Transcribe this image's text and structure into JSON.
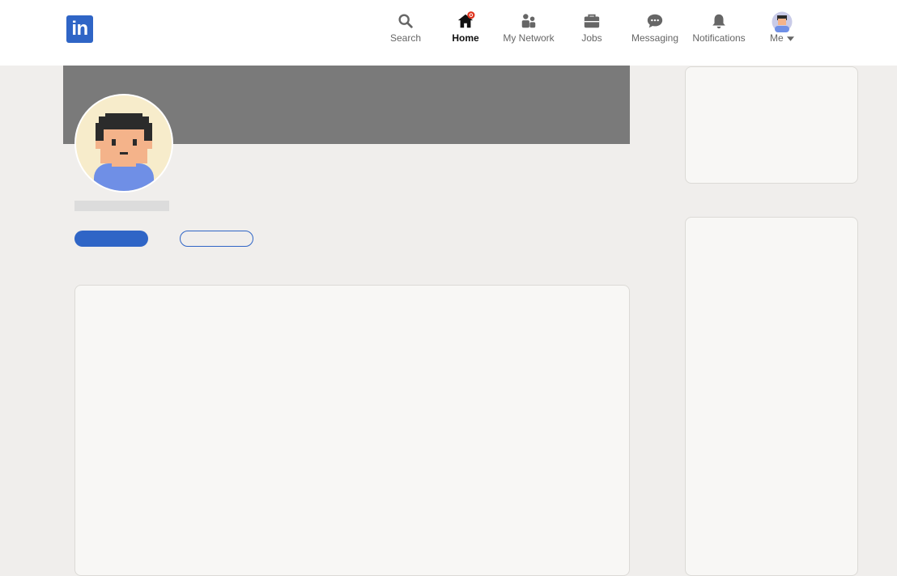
{
  "nav": {
    "items": [
      {
        "label": "Search",
        "icon": "search-icon"
      },
      {
        "label": "Home",
        "icon": "home-icon"
      },
      {
        "label": "My Network",
        "icon": "network-icon"
      },
      {
        "label": "Jobs",
        "icon": "briefcase-icon"
      },
      {
        "label": "Messaging",
        "icon": "messaging-icon"
      },
      {
        "label": "Notifications",
        "icon": "bell-icon"
      },
      {
        "label": "Me",
        "icon": "avatar-icon"
      }
    ],
    "active": "Home"
  },
  "logo": {
    "text": "in",
    "color": "#2f65c6"
  },
  "colors": {
    "accent": "#2f65c6",
    "banner": "#7a7a7a",
    "background": "#f0eeec",
    "card": "#f8f7f5",
    "notification_dot": "#e0331d"
  }
}
